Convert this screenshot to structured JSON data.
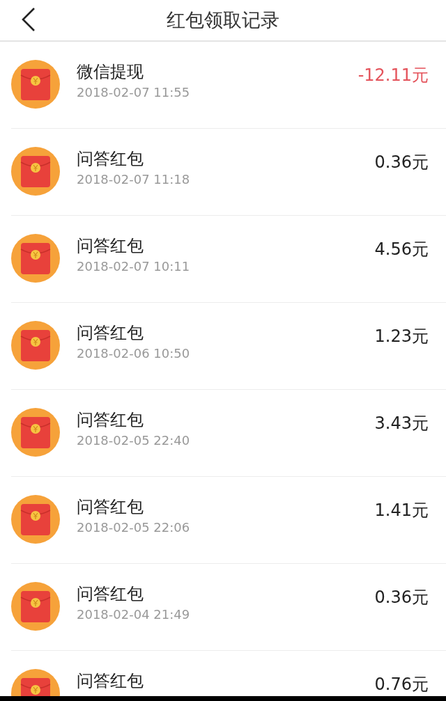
{
  "header": {
    "title": "红包领取记录"
  },
  "records": [
    {
      "title": "微信提现",
      "time": "2018-02-07  11:55",
      "amount": "-12.11元",
      "kind": "withdrawal"
    },
    {
      "title": "问答红包",
      "time": "2018-02-07  11:18",
      "amount": "0.36元",
      "kind": "income"
    },
    {
      "title": "问答红包",
      "time": "2018-02-07  10:11",
      "amount": "4.56元",
      "kind": "income"
    },
    {
      "title": "问答红包",
      "time": "2018-02-06  10:50",
      "amount": "1.23元",
      "kind": "income"
    },
    {
      "title": "问答红包",
      "time": "2018-02-05  22:40",
      "amount": "3.43元",
      "kind": "income"
    },
    {
      "title": "问答红包",
      "time": "2018-02-05  22:06",
      "amount": "1.41元",
      "kind": "income"
    },
    {
      "title": "问答红包",
      "time": "2018-02-04  21:49",
      "amount": "0.36元",
      "kind": "income"
    },
    {
      "title": "问答红包",
      "amount": "0.76元",
      "kind": "income"
    }
  ]
}
